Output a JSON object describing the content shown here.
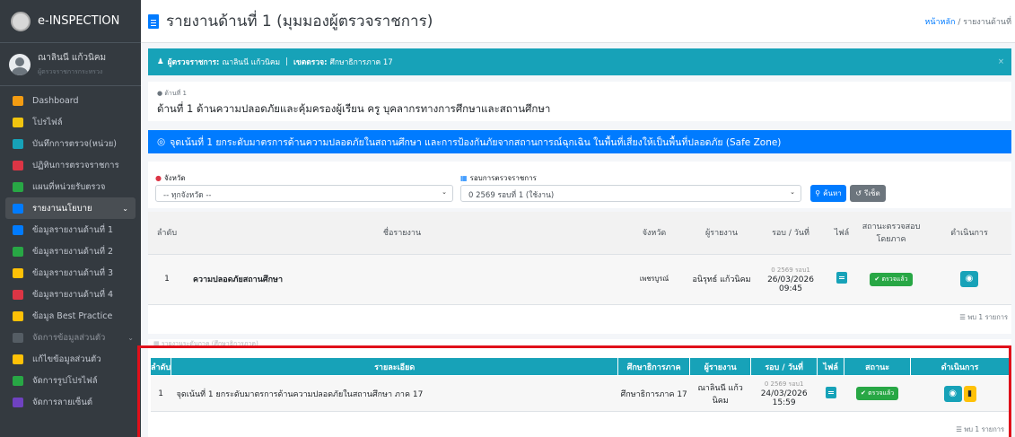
{
  "app": {
    "brand": "e-INSPECTION",
    "user_name": "ณาลินนี แก้วนิคม",
    "user_role": "ผู้ตรวจราชการกระทรวง"
  },
  "sidebar": {
    "items": [
      {
        "label": "Dashboard",
        "color": "#f39c12"
      },
      {
        "label": "โปรไฟล์",
        "color": "#f1c40f"
      },
      {
        "label": "บันทึกการตรวจ(หน่วย)",
        "color": "#17a2b8"
      },
      {
        "label": "ปฏิทินการตรวจราชการ",
        "color": "#dc3545"
      },
      {
        "label": "แผนที่หน่วยรับตรวจ",
        "color": "#28a745"
      },
      {
        "label": "รายงานนโยบาย",
        "color": "#007bff"
      },
      {
        "label": "ข้อมูลรายงานด้านที่ 1",
        "color": "#007bff"
      },
      {
        "label": "ข้อมูลรายงานด้านที่ 2",
        "color": "#28a745"
      },
      {
        "label": "ข้อมูลรายงานด้านที่ 3",
        "color": "#ffc107"
      },
      {
        "label": "ข้อมูลรายงานด้านที่ 4",
        "color": "#dc3545"
      },
      {
        "label": "ข้อมูล Best Practice",
        "color": "#ffc107"
      },
      {
        "label": "จัดการข้อมูลส่วนตัว",
        "color": "#6c757d"
      },
      {
        "label": "แก้ไขข้อมูลส่วนตัว",
        "color": "#ffc107"
      },
      {
        "label": "จัดการรูปโปรไฟล์",
        "color": "#28a745"
      },
      {
        "label": "จัดการลายเซ็นต์",
        "color": "#6f42c1"
      }
    ]
  },
  "header": {
    "title": "รายงานด้านที่ 1 (มุมมองผู้ตรวจราชการ)",
    "breadcrumb_home": "หน้าหลัก",
    "breadcrumb_sep": "/",
    "breadcrumb_current": "รายงานด้านที่"
  },
  "info": {
    "inspector_label": "ผู้ตรวจราชการ:",
    "inspector_value": "ณาลินนี แก้วนิคม",
    "divider": "|",
    "area_label": "เขตตรวจ:",
    "area_value": "ศึกษาธิการภาค 17",
    "close": "×"
  },
  "aspect": {
    "small": "ด้านที่ 1",
    "title": "ด้านที่ 1 ด้านความปลอดภัยและคุ้มครองผู้เรียน ครู บุคลากรทางการศึกษาและสถานศึกษา"
  },
  "point": {
    "text": "จุดเน้นที่ 1 ยกระดับมาตรการด้านความปลอดภัยในสถานศึกษา และการป้องกันภัยจากสถานการณ์ฉุกเฉิน ในพื้นที่เสี่ยงให้เป็นพื้นที่ปลอดภัย (Safe Zone)"
  },
  "filter": {
    "province_label": "จังหวัด",
    "province_value": "-- ทุกจังหวัด --",
    "round_label": "รอบการตรวจราชการ",
    "round_value": "0 2569 รอบที่ 1 (ใช้งาน)",
    "search_label": "ค้นหา",
    "reset_label": "รีเซ็ต"
  },
  "table1": {
    "headers": [
      "ลำดับ",
      "ชื่อรายงาน",
      "จังหวัด",
      "ผู้รายงาน",
      "รอบ / วันที่",
      "ไฟล์",
      "สถานะตรวจสอบโดยภาค",
      "ดำเนินการ"
    ],
    "row": {
      "no": "1",
      "name": "ความปลอดภัยสถานศึกษา",
      "province": "เพชรบูรณ์",
      "reporter": "อนิรุทธ์ แก้วนิคม",
      "round": "0 2569 รอบ1",
      "date": "26/03/2026",
      "time": "09:45",
      "status": "ตรวจแล้ว"
    },
    "found": "พบ 1 รายการ"
  },
  "card2": {
    "title": "รายงานระดับภาค (ศึกษาธิการภาค)"
  },
  "table2": {
    "headers": [
      "ลำดับ",
      "รายละเอียด",
      "ศึกษาธิการภาค",
      "ผู้รายงาน",
      "รอบ / วันที่",
      "ไฟล์",
      "สถานะ",
      "ดำเนินการ"
    ],
    "row": {
      "no": "1",
      "detail": "จุดเน้นที่ 1 ยกระดับมาตรการด้านความปลอดภัยในสถานศึกษา ภาค 17",
      "region": "ศึกษาธิการภาค 17",
      "reporter": "ณาลินนี แก้วนิคม",
      "round": "0 2569 รอบ1",
      "date": "24/03/2026",
      "time": "15:59",
      "status": "ตรวจแล้ว"
    },
    "found": "พบ 1 รายการ"
  }
}
